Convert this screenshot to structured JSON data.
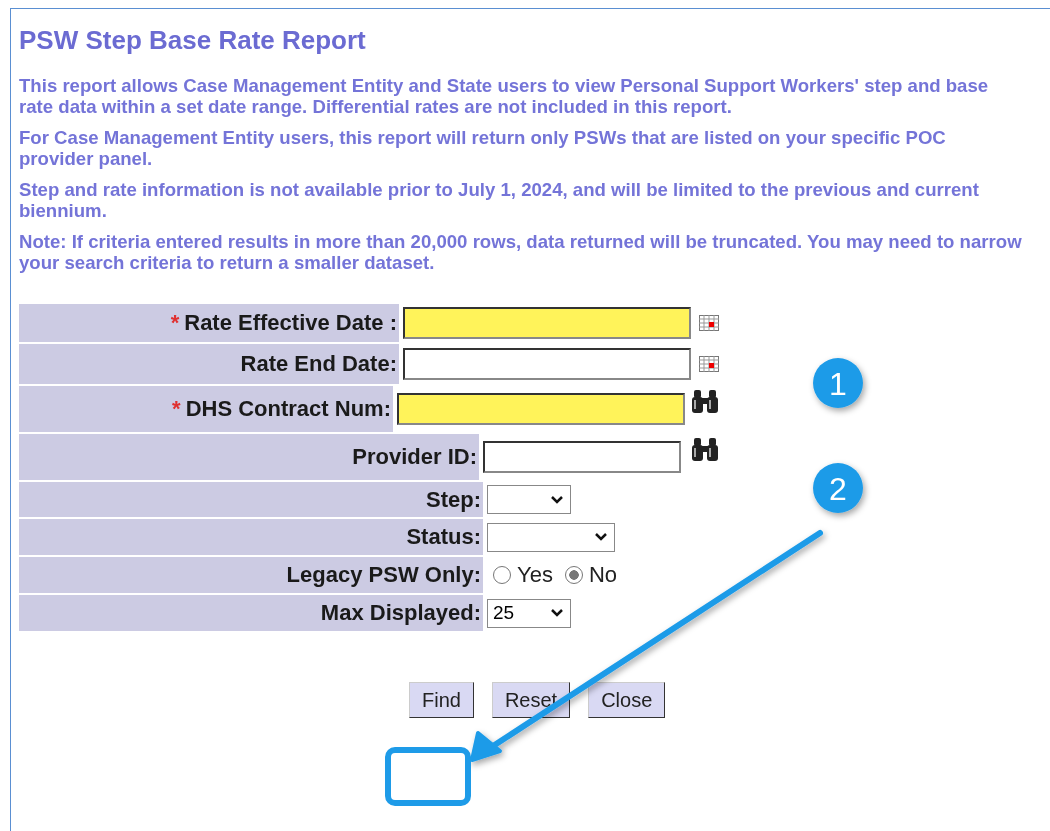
{
  "title": "PSW Step Base Rate Report",
  "paragraphs": [
    "This report allows Case Management Entity and State users to view Personal Support Workers' step and base rate data within a set date range. Differential rates are not included in this report.",
    "For Case Management Entity users, this report will return only PSWs that are listed on your specific POC provider panel.",
    "Step and rate information is not available prior to July 1, 2024, and will be limited to the previous and current biennium.",
    "Note: If criteria entered results in more than 20,000 rows, data returned will be truncated. You may need to narrow your search criteria to return a smaller dataset."
  ],
  "fields": [
    {
      "kind": "date",
      "required_mark": "*",
      "label": "Rate Effective Date :",
      "highlighted": true
    },
    {
      "kind": "date",
      "label": "Rate End Date:",
      "highlighted": false
    },
    {
      "kind": "lookup",
      "required_mark": "*",
      "label": "DHS Contract Num:",
      "highlighted": true
    },
    {
      "kind": "lookup",
      "label": "Provider ID:",
      "highlighted": false
    },
    {
      "kind": "select",
      "label": "Step:"
    },
    {
      "kind": "select",
      "label": "Status:"
    },
    {
      "kind": "radio",
      "label": "Legacy PSW Only:",
      "options": [
        {
          "label": "Yes",
          "selected": false
        },
        {
          "label": "No",
          "selected": true
        }
      ]
    },
    {
      "kind": "select",
      "label": "Max Displayed:",
      "value": "25"
    }
  ],
  "buttons": [
    "Find",
    "Reset",
    "Close"
  ],
  "callouts": [
    "1",
    "2"
  ]
}
